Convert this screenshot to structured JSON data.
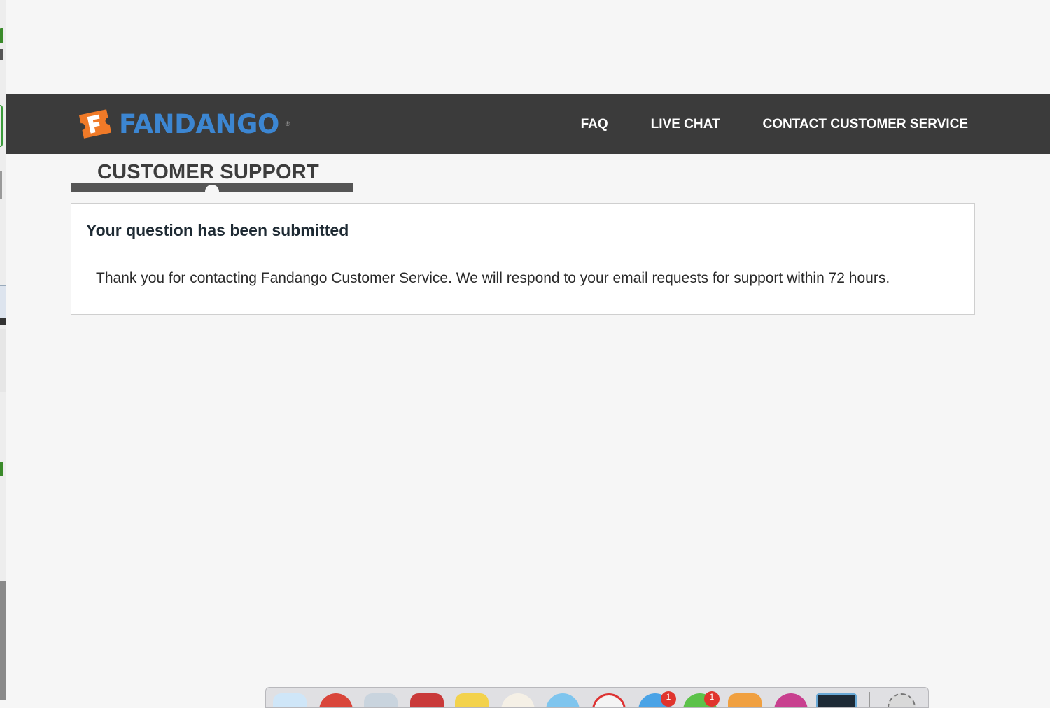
{
  "header": {
    "brand": "FANDANGO",
    "nav": [
      {
        "label": "FAQ"
      },
      {
        "label": "LIVE CHAT"
      },
      {
        "label": "CONTACT CUSTOMER SERVICE"
      }
    ]
  },
  "section": {
    "title": "CUSTOMER SUPPORT"
  },
  "confirmation": {
    "heading": "Your question has been submitted",
    "message": "Thank you for contacting Fandango Customer Service. We will respond to your email requests for support within 72 hours."
  },
  "dock": {
    "badges": [
      "1",
      "1"
    ]
  },
  "colors": {
    "header_bg": "#3b3b3b",
    "brand_blue": "#3c86d2",
    "brand_orange": "#f07a28",
    "page_bg": "#f6f6f6",
    "panel_bg": "#ffffff"
  }
}
